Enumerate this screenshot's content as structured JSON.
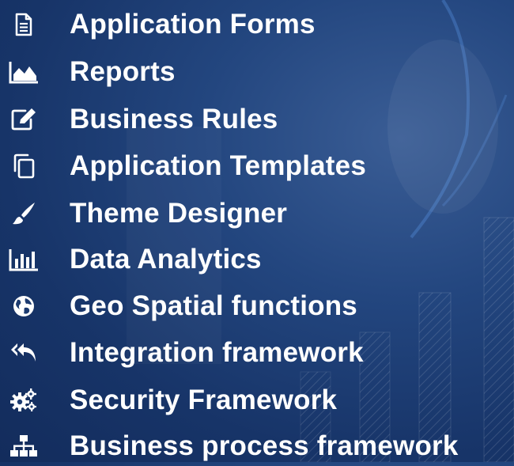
{
  "features": [
    {
      "label": "Application Forms",
      "icon": "document-icon"
    },
    {
      "label": "Reports",
      "icon": "area-chart-icon"
    },
    {
      "label": "Business Rules",
      "icon": "edit-icon"
    },
    {
      "label": "Application Templates",
      "icon": "copy-icon"
    },
    {
      "label": "Theme Designer",
      "icon": "paint-brush-icon"
    },
    {
      "label": "Data Analytics",
      "icon": "bar-chart-icon"
    },
    {
      "label": "Geo Spatial functions",
      "icon": "globe-icon"
    },
    {
      "label": "Integration framework",
      "icon": "reply-all-icon"
    },
    {
      "label": "Security Framework",
      "icon": "gears-icon"
    },
    {
      "label": "Business process framework",
      "icon": "sitemap-icon"
    }
  ],
  "colors": {
    "text": "#ffffff",
    "background": "#1c3b70"
  }
}
